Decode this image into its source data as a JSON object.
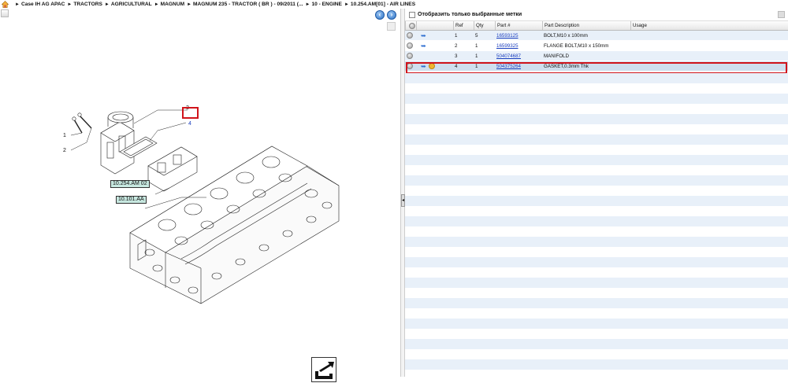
{
  "breadcrumb": [
    "Case IH AG APAC",
    "TRACTORS",
    "AGRICULTURAL",
    "MAGNUM",
    "MAGNUM 235 - TRACTOR ( BR ) - 09/2011 (...",
    "10 - ENGINE",
    "10.254.AM[01] - AIR LINES"
  ],
  "drawing": {
    "callouts": [
      "3",
      "4",
      "1",
      "2"
    ],
    "tag_1": "10.254.AM 02",
    "tag_2": "10.101.AA"
  },
  "filter": {
    "label": "Отобразить только выбранные метки",
    "checked": false
  },
  "table": {
    "headers": [
      "",
      "",
      "Ref",
      "Qty",
      "Part #",
      "Part Description",
      "Usage"
    ],
    "rows": [
      {
        "ref": "1",
        "qty": "5",
        "part": "16593125",
        "desc": "BOLT,M10 x 100mm",
        "usage": "",
        "icons": [
          "circle-icon",
          "arrow-icon"
        ]
      },
      {
        "ref": "2",
        "qty": "1",
        "part": "16599325",
        "desc": "FLANGE BOLT,M10 x 150mm",
        "usage": "",
        "icons": [
          "circle-icon",
          "arrow-icon"
        ]
      },
      {
        "ref": "3",
        "qty": "1",
        "part": "504074687",
        "desc": "MANIFOLD",
        "usage": "",
        "icons": [
          "circle-icon"
        ]
      },
      {
        "ref": "4",
        "qty": "1",
        "part": "504375264",
        "desc": "GASKET,0.3mm Thk",
        "usage": "",
        "icons": [
          "circle-icon",
          "arrow-icon",
          "note-icon"
        ],
        "selected": true
      }
    ]
  },
  "colors": {
    "selection_outline": "#d1141b",
    "row_alt": "#e8f0f9",
    "row_selected": "#cfdfee",
    "tag_bg": "#c7e8e0",
    "link": "#1b3fbf"
  }
}
